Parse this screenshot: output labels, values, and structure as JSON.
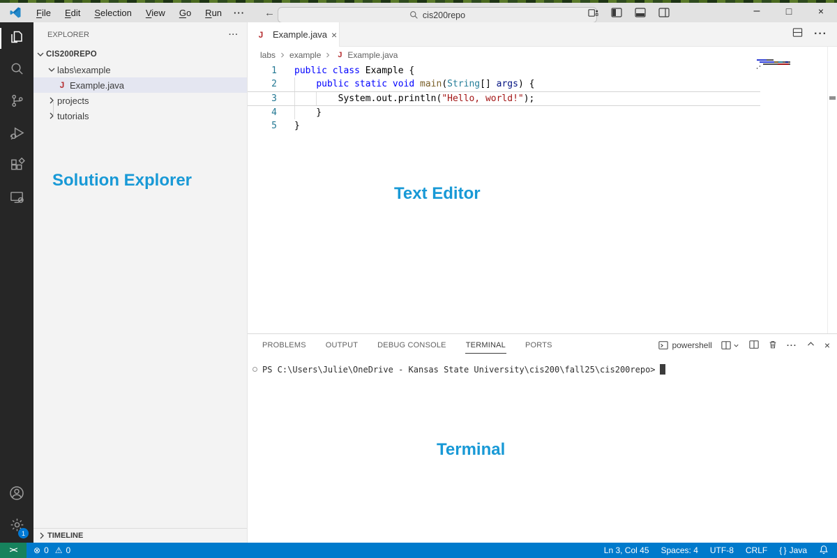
{
  "titlebar": {
    "menus": [
      "File",
      "Edit",
      "Selection",
      "View",
      "Go",
      "Run"
    ],
    "menu_overflow": "···",
    "search_value": "cis200repo"
  },
  "activity_bar": {
    "icons": [
      "files-icon",
      "search-icon",
      "source-control-icon",
      "run-debug-icon",
      "extensions-icon",
      "remote-explorer-icon",
      "account-icon",
      "settings-gear-icon"
    ],
    "settings_badge": "1"
  },
  "explorer": {
    "title": "EXPLORER",
    "actions": "···",
    "root": "CIS200REPO",
    "folder": "labs\\example",
    "file": "Example.java",
    "collapsed": [
      "projects",
      "tutorials"
    ],
    "timeline": "TIMELINE"
  },
  "editor": {
    "tab": "Example.java",
    "breadcrumbs": [
      "labs",
      "example",
      "Example.java"
    ],
    "actions": "···",
    "code_lines": [
      {
        "num": "1",
        "guides": 0,
        "tokens": [
          {
            "c": "kw",
            "t": "public class "
          },
          {
            "c": "pln",
            "t": "Example {"
          }
        ]
      },
      {
        "num": "2",
        "guides": 1,
        "tokens": [
          {
            "c": "pln",
            "t": "    "
          },
          {
            "c": "kw",
            "t": "public static void "
          },
          {
            "c": "fn",
            "t": "main"
          },
          {
            "c": "pln",
            "t": "("
          },
          {
            "c": "typ",
            "t": "String"
          },
          {
            "c": "pln",
            "t": "[] "
          },
          {
            "c": "var",
            "t": "args"
          },
          {
            "c": "pln",
            "t": ") {"
          }
        ]
      },
      {
        "num": "3",
        "guides": 2,
        "current": true,
        "tokens": [
          {
            "c": "pln",
            "t": "        System.out.println("
          },
          {
            "c": "str",
            "t": "\"Hello, world!\""
          },
          {
            "c": "pln",
            "t": ");"
          }
        ]
      },
      {
        "num": "4",
        "guides": 1,
        "tokens": [
          {
            "c": "pln",
            "t": "    }"
          }
        ]
      },
      {
        "num": "5",
        "guides": 0,
        "tokens": [
          {
            "c": "pln",
            "t": "}"
          }
        ]
      }
    ]
  },
  "panel": {
    "tabs": [
      "PROBLEMS",
      "OUTPUT",
      "DEBUG CONSOLE",
      "TERMINAL",
      "PORTS"
    ],
    "active_tab": "TERMINAL",
    "shell_label": "powershell",
    "actions": "···",
    "prompt": "PS C:\\Users\\Julie\\OneDrive - Kansas State University\\cis200\\fall25\\cis200repo>"
  },
  "status_bar": {
    "errors": "0",
    "warnings": "0",
    "line_col": "Ln 3, Col 45",
    "spaces": "Spaces: 4",
    "encoding": "UTF-8",
    "eol": "CRLF",
    "language": "Java"
  },
  "annotations": {
    "solution_explorer": "Solution Explorer",
    "text_editor": "Text Editor",
    "terminal": "Terminal"
  },
  "colors": {
    "annotation_blue": "#1899d6",
    "status_blue": "#007acc",
    "remote_green": "#16825d",
    "java_icon_red": "#b52e31",
    "selection_bg": "#e4e6f1",
    "keyword_blue": "#0000ff",
    "string_red": "#a31515",
    "line_number": "#237893"
  }
}
